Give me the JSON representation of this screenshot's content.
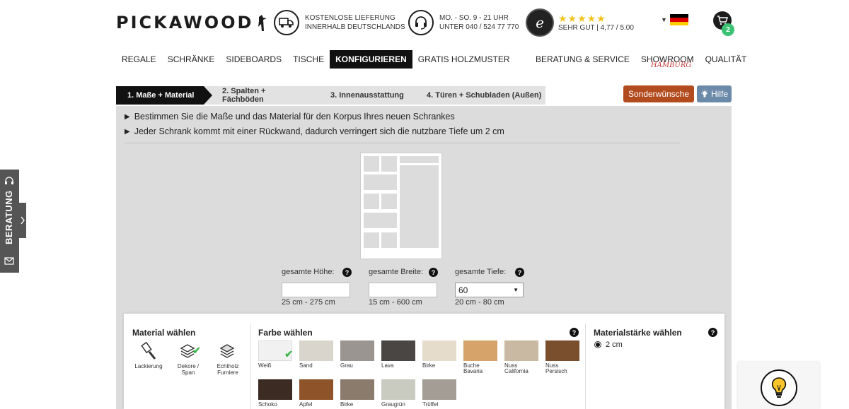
{
  "brand": {
    "logo_text": "PICKAWOOD"
  },
  "header_info": {
    "delivery": {
      "line1": "KOSTENLOSE LIEFERUNG",
      "line2": "INNERHALB DEUTSCHLANDS"
    },
    "hotline": {
      "line1": "MO. - SO. 9 - 21 UHR",
      "line2": "UNTER 040 / 524 77 770"
    },
    "rating": {
      "stars": "★★★★★",
      "text": "SEHR GUT | 4,77 / 5.00"
    }
  },
  "cart": {
    "count": "2"
  },
  "nav": {
    "left": [
      "REGALE",
      "SCHRÄNKE",
      "SIDEBOARDS",
      "TISCHE",
      "KONFIGURIEREN",
      "GRATIS HOLZMUSTER"
    ],
    "right": [
      "BERATUNG & SERVICE",
      "SHOWROOM",
      "QUALITÄT"
    ],
    "showroom_sub": "Hamburg",
    "active": "KONFIGURIEREN"
  },
  "steps": [
    "1. Maße + Material",
    "2. Spalten + Fächböden",
    "3. Innenausstattung",
    "4. Türen + Schubladen (Außen)"
  ],
  "buttons": {
    "sonder": "Sonderwünsche",
    "hilfe": "Hilfe"
  },
  "instructions": [
    "Bestimmen Sie die Maße und das Material für den Korpus Ihres neuen Schrankes",
    "Jeder Schrank kommt mit einer Rückwand, dadurch verringert sich die nutzbare Tiefe um 2 cm"
  ],
  "dimensions": {
    "height": {
      "label": "gesamte Höhe:",
      "value": "",
      "range": "25 cm - 275 cm"
    },
    "width": {
      "label": "gesamte Breite:",
      "value": "",
      "range": "15 cm - 600 cm"
    },
    "depth": {
      "label": "gesamte Tiefe:",
      "value": "60",
      "range": "20 cm - 80 cm"
    }
  },
  "material": {
    "title": "Material wählen",
    "options": [
      {
        "label_1": "Lackierung",
        "label_2": ""
      },
      {
        "label_1": "Dekore /",
        "label_2": "Span"
      },
      {
        "label_1": "Echtholz",
        "label_2": "Furniere"
      }
    ]
  },
  "color": {
    "title": "Farbe wählen",
    "swatches": [
      {
        "name": "Weiß",
        "name2": "",
        "color": "#f1f1f1"
      },
      {
        "name": "Sand",
        "name2": "",
        "color": "#d9d5cc"
      },
      {
        "name": "Grau",
        "name2": "",
        "color": "#9a9590"
      },
      {
        "name": "Lava",
        "name2": "",
        "color": "#4a4644"
      },
      {
        "name": "Birke",
        "name2": "",
        "color": "#e6dccc"
      },
      {
        "name": "Buche",
        "name2": "Bavaria",
        "color": "#d6a46a"
      },
      {
        "name": "Nuss",
        "name2": "California",
        "color": "#c9b8a2"
      },
      {
        "name": "Nuss",
        "name2": "Persisch",
        "color": "#7a4f2e"
      },
      {
        "name": "Schoko",
        "name2": "",
        "color": "#3b2b22"
      },
      {
        "name": "Apfel",
        "name2": "",
        "color": "#8f532a"
      },
      {
        "name": "Birke",
        "name2": "",
        "color": "#8a7b6c"
      },
      {
        "name": "Graugrün",
        "name2": "",
        "color": "#c9cbc0"
      },
      {
        "name": "Trüffel",
        "name2": "",
        "color": "#a39d96"
      }
    ]
  },
  "thickness": {
    "title": "Materialstärke wählen",
    "option": "2 cm"
  },
  "side_tab": {
    "label": "BERATUNG"
  }
}
